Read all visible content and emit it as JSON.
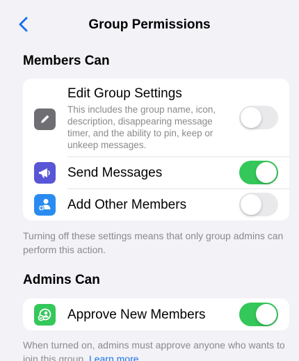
{
  "nav": {
    "back_icon": "chevron-left-icon",
    "title": "Group Permissions"
  },
  "members_section": {
    "header": "Members Can",
    "items": [
      {
        "icon": "pencil-icon",
        "icon_color": "#6e6e73",
        "title": "Edit Group Settings",
        "description": "This includes the group name, icon, description, disappearing message timer, and the ability to pin, keep or unkeep messages.",
        "enabled": false
      },
      {
        "icon": "megaphone-icon",
        "icon_color": "#5856d6",
        "title": "Send Messages",
        "enabled": true
      },
      {
        "icon": "add-member-icon",
        "icon_color": "#2a8cf0",
        "title": "Add Other Members",
        "enabled": false
      }
    ],
    "footnote": "Turning off these settings means that only group admins can perform this action."
  },
  "admins_section": {
    "header": "Admins Can",
    "items": [
      {
        "icon": "approve-members-icon",
        "icon_color": "#34c759",
        "title": "Approve New Members",
        "enabled": true
      }
    ],
    "footnote": "When turned on, admins must approve anyone who wants to join this group.",
    "footnote_link": "Learn more"
  },
  "colors": {
    "background": "#f2f2f7",
    "accent": "#1a73e8",
    "toggle_on": "#34c759",
    "toggle_off": "#e9e9eb"
  }
}
